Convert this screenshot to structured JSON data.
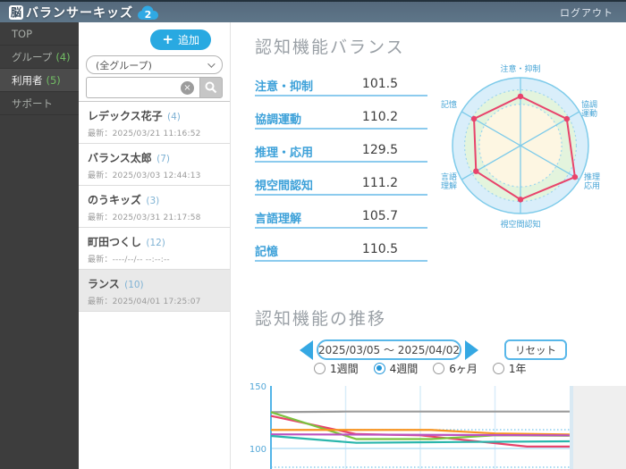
{
  "header": {
    "logo_symbol": "脳",
    "logo_text": "バランサーキッズ",
    "logo_badge": "2",
    "logout_label": "ログアウト"
  },
  "sidebar": {
    "items": [
      {
        "label": "TOP",
        "count": "",
        "active": false
      },
      {
        "label": "グループ",
        "count": "(4)",
        "active": false
      },
      {
        "label": "利用者",
        "count": "(5)",
        "active": true
      },
      {
        "label": "サポート",
        "count": "",
        "active": false
      }
    ],
    "count_color": "#72bd64"
  },
  "user_panel": {
    "add_button_label": "追加",
    "group_select_value": "(全グループ)",
    "search_value": "",
    "users": [
      {
        "name": "レデックス花子",
        "count": "(4)",
        "latest": "最新：2025/03/21 11:16:52",
        "selected": false
      },
      {
        "name": "バランス太郎",
        "count": "(7)",
        "latest": "最新：2025/03/03 12:44:13",
        "selected": false
      },
      {
        "name": "のうキッズ",
        "count": "(3)",
        "latest": "最新：2025/03/31 21:17:58",
        "selected": false
      },
      {
        "name": "町田つくし",
        "count": "(12)",
        "latest": "最新：----/--/-- --:--:--",
        "selected": false
      },
      {
        "name": "ランス",
        "count": "(10)",
        "latest": "最新：2025/04/01 17:25:07",
        "selected": true
      }
    ]
  },
  "balance_section": {
    "title": "認知機能バランス",
    "metrics": [
      {
        "label": "注意・抑制",
        "value": "101.5"
      },
      {
        "label": "協調運動",
        "value": "110.2"
      },
      {
        "label": "推理・応用",
        "value": "129.5"
      },
      {
        "label": "視空間認知",
        "value": "111.2"
      },
      {
        "label": "言語理解",
        "value": "105.7"
      },
      {
        "label": "記憶",
        "value": "110.5"
      }
    ],
    "accent_color": "#3da1d9"
  },
  "trend_section": {
    "title": "認知機能の推移",
    "date_range": "2025/03/05 ～ 2025/04/02",
    "reset_label": "リセット",
    "period_options": [
      {
        "label": "1週間",
        "selected": false
      },
      {
        "label": "4週間",
        "selected": true
      },
      {
        "label": "6ヶ月",
        "selected": false
      },
      {
        "label": "1年",
        "selected": false
      }
    ]
  },
  "chart_data": [
    {
      "type": "radar",
      "title": "認知機能バランス",
      "axes": [
        "注意・抑制",
        "協調運動",
        "推理・応用",
        "視空間認知",
        "言語理解",
        "記憶"
      ],
      "values": [
        101.5,
        110.2,
        129.5,
        111.2,
        105.7,
        110.5
      ],
      "rmax": 140,
      "normal_band": [
        85,
        115
      ],
      "series_color": "#e8436b",
      "band_colors": {
        "outer": "#d9eefa",
        "normal": "#e3f4dd",
        "inner": "#fdf6e2"
      },
      "axis_color": "#7ecbea",
      "label_color": "#46a4d6"
    },
    {
      "type": "line",
      "title": "認知機能の推移",
      "x_start": "2025/03/05",
      "x_end": "2025/04/02",
      "x_unit": "days",
      "x_max": 28,
      "yticks": [
        100,
        150
      ],
      "ylim_visible_top": 150,
      "reference_lines": {
        "solid": [
          100
        ],
        "dotted": [
          115,
          85
        ]
      },
      "grid": true,
      "series": [
        {
          "name": "推理・応用",
          "color": "#9b9b9b",
          "points": [
            [
              0,
              129
            ],
            [
              7,
              129.5
            ],
            [
              28,
              129.5
            ]
          ]
        },
        {
          "name": "注意・抑制",
          "color": "#e8436b",
          "points": [
            [
              0,
              126
            ],
            [
              8,
              111.5
            ],
            [
              14,
              110.5
            ],
            [
              24,
              101.5
            ],
            [
              28,
              101.5
            ]
          ]
        },
        {
          "name": "協調運動",
          "color": "#7cc23e",
          "points": [
            [
              0,
              129
            ],
            [
              8,
              107.5
            ],
            [
              15,
              107.5
            ],
            [
              21,
              110.5
            ],
            [
              28,
              110.2
            ]
          ]
        },
        {
          "name": "視空間認知",
          "color": "#f79420",
          "points": [
            [
              0,
              114.8
            ],
            [
              15,
              114.8
            ],
            [
              21,
              112
            ],
            [
              28,
              111.2
            ]
          ]
        },
        {
          "name": "記憶",
          "color": "#bb52c0",
          "points": [
            [
              0,
              111.3
            ],
            [
              28,
              110.5
            ]
          ]
        },
        {
          "name": "言語理解",
          "color": "#2ab6ac",
          "points": [
            [
              0,
              110
            ],
            [
              8,
              104.5
            ],
            [
              15,
              105
            ],
            [
              28,
              105.7
            ]
          ]
        }
      ]
    }
  ]
}
